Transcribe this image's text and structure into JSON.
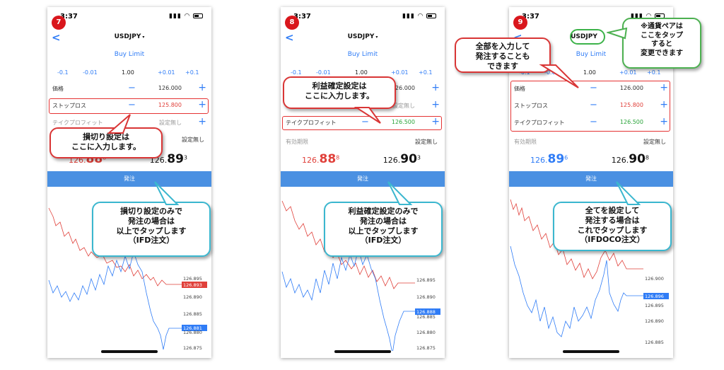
{
  "common": {
    "time": "3:37",
    "symbol": "USDJPY",
    "order_type": "Buy Limit",
    "order_button": "発注",
    "steps": [
      "-0.1",
      "-0.01",
      "1.00",
      "+0.01",
      "+0.1"
    ],
    "labels": {
      "price": "価格",
      "stop_loss": "ストップロス",
      "take_profit": "テイクプロフィット",
      "expiry": "有効期限"
    },
    "not_set": "設定無し",
    "minus_glyph": "−",
    "plus_glyph": "+",
    "back_glyph": "<",
    "caret_glyph": "▾"
  },
  "phones": [
    {
      "step": "7",
      "price": "126.000",
      "stop_loss": "125.800",
      "take_profit": "設定無し",
      "expiry": "設定無し",
      "bid": {
        "main": "126.",
        "big": "88",
        "sup": "8"
      },
      "ask": {
        "main": "126.",
        "big": "89",
        "sup": "3"
      },
      "chart_labels": [
        "126.895",
        "126.893",
        "126.890",
        "126.885",
        "126.881",
        "126.880",
        "126.875"
      ],
      "callout_main": [
        "損切り設定は",
        "ここに入力します。"
      ],
      "callout_order": [
        "損切り設定のみで",
        "発注の場合は",
        "以上でタップします",
        "（IFD注文）"
      ]
    },
    {
      "step": "8",
      "price": "126.000",
      "stop_loss": "設定無し",
      "take_profit": "126.500",
      "expiry": "設定無し",
      "bid": {
        "main": "126.",
        "big": "88",
        "sup": "8"
      },
      "ask": {
        "main": "126.",
        "big": "90",
        "sup": "3"
      },
      "chart_labels": [
        "126.895",
        "126.890",
        "126.888",
        "126.885",
        "126.880",
        "126.875"
      ],
      "callout_main": [
        "利益確定設定は",
        "ここに入力します。"
      ],
      "callout_order": [
        "利益確定設定のみで",
        "発注の場合は",
        "以上でタップします",
        "（IFD注文）"
      ]
    },
    {
      "step": "9",
      "price": "126.000",
      "stop_loss": "125.800",
      "take_profit": "126.500",
      "expiry": "設定無し",
      "bid": {
        "main": "126.",
        "big": "89",
        "sup": "6"
      },
      "ask": {
        "main": "126.",
        "big": "90",
        "sup": "8"
      },
      "chart_labels": [
        "126.900",
        "126.896",
        "126.895",
        "126.890",
        "126.885"
      ],
      "callout_main": [
        "全部を入力して",
        "発注することも",
        "できます"
      ],
      "callout_pair": [
        "※通貨ペアは",
        "ここをタップ",
        "すると",
        "変更できます"
      ],
      "callout_order": [
        "全てを設定して",
        "発注する場合は",
        "これでタップします",
        "（IFDOCO注文）"
      ]
    }
  ],
  "colors": {
    "accent": "#2f7cf6",
    "button": "#4a90e2",
    "bid_red": "#e0403a",
    "tp_green": "#2aa43a",
    "callout_red": "#d93636",
    "callout_blue": "#3bb7cf",
    "callout_green": "#4cb050",
    "step_badge": "#d9161c"
  }
}
